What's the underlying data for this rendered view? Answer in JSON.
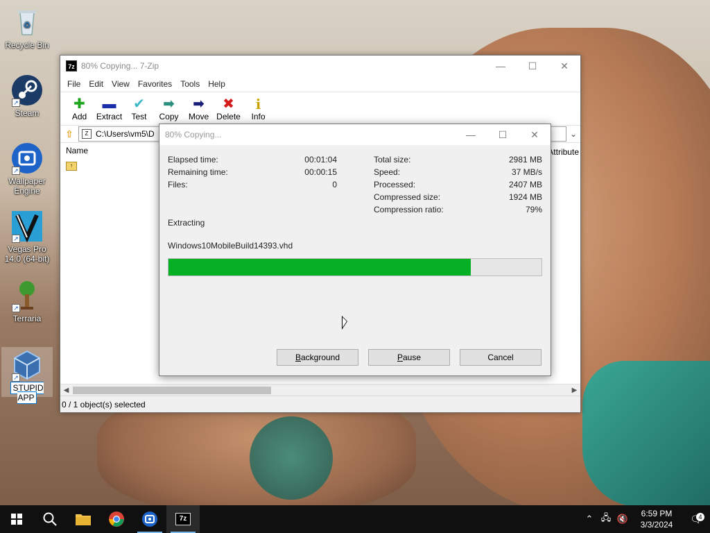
{
  "desktop": {
    "icons": [
      {
        "label": "Recycle Bin",
        "icon": "recycle-bin-icon"
      },
      {
        "label": "Steam",
        "icon": "steam-icon"
      },
      {
        "label": "Wallpaper Engine",
        "icon": "wallpaper-engine-icon"
      },
      {
        "label": "Vegas Pro 14.0 (64-bit)",
        "icon": "vegas-pro-icon"
      },
      {
        "label": "Terraria",
        "icon": "terraria-icon"
      },
      {
        "label": "STUPID APP",
        "icon": "virtualbox-icon"
      }
    ]
  },
  "main_window": {
    "title": "80% Copying... 7-Zip",
    "app_icon_text": "7z",
    "menu": [
      "File",
      "Edit",
      "View",
      "Favorites",
      "Tools",
      "Help"
    ],
    "toolbar": [
      {
        "label": "Add",
        "icon": "plus-icon",
        "glyph": "✚",
        "color": "#1ea51e"
      },
      {
        "label": "Extract",
        "icon": "minus-icon",
        "glyph": "▬",
        "color": "#1a2fa8"
      },
      {
        "label": "Test",
        "icon": "checkmark-icon",
        "glyph": "✔",
        "color": "#3bb9c6"
      },
      {
        "label": "Copy",
        "icon": "copy-arrow-icon",
        "glyph": "➡",
        "color": "#2a8f7d"
      },
      {
        "label": "Move",
        "icon": "move-arrow-icon",
        "glyph": "➡",
        "color": "#1a1f7a"
      },
      {
        "label": "Delete",
        "icon": "delete-x-icon",
        "glyph": "✖",
        "color": "#d41a1a"
      },
      {
        "label": "Info",
        "icon": "info-icon",
        "glyph": "i",
        "color": "#c9a400"
      }
    ],
    "address": "C:\\Users\\vm5\\D",
    "address_icon_text": "Z",
    "columns": {
      "name": "Name",
      "attributes": "Attribute"
    },
    "status": "0 / 1 object(s) selected"
  },
  "dialog": {
    "title": "80% Copying...",
    "left_stats": [
      {
        "label": "Elapsed time:",
        "value": "00:01:04"
      },
      {
        "label": "Remaining time:",
        "value": "00:00:15"
      },
      {
        "label": "Files:",
        "value": "0"
      }
    ],
    "right_stats": [
      {
        "label": "Total size:",
        "value": "2981 MB"
      },
      {
        "label": "Speed:",
        "value": "37 MB/s"
      },
      {
        "label": "Processed:",
        "value": "2407 MB"
      },
      {
        "label": "Compressed size:",
        "value": "1924 MB"
      },
      {
        "label": "Compression ratio:",
        "value": "79%"
      }
    ],
    "operation": "Extracting",
    "filename": "Windows10MobileBuild14393.vhd",
    "progress_fraction": 0.81,
    "buttons": {
      "background_first": "B",
      "background_rest": "ackground",
      "pause_first": "P",
      "pause_rest": "ause",
      "cancel": "Cancel"
    }
  },
  "taskbar": {
    "clock_time": "6:59 PM",
    "clock_date": "3/3/2024",
    "notification_count": "4"
  }
}
